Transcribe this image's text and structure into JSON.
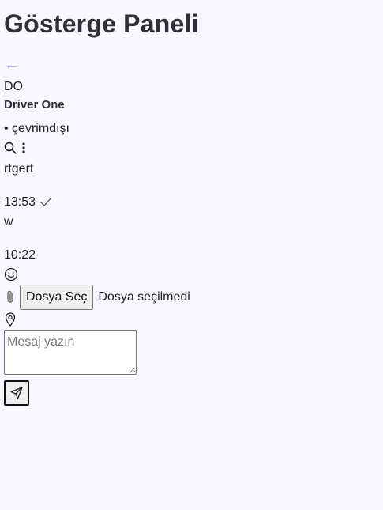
{
  "page": {
    "title": "Gösterge Paneli"
  },
  "chat_header": {
    "back_arrow": "←",
    "avatar_initials": "DO",
    "contact_name": "Driver One",
    "status": "• çevrimdışı",
    "icons": [
      "search-icon",
      "more-vertical-icon"
    ]
  },
  "messages": [
    {
      "text": "rtgert",
      "time": "13:53",
      "read_receipt": "check-icon"
    },
    {
      "text": "w",
      "time": "10:22"
    }
  ],
  "composer": {
    "emoji_icon": "smile-icon",
    "attach_icon": "paperclip-icon",
    "file_button_label": "Dosya Seç",
    "file_status": "Dosya seçilmedi",
    "location_icon": "map-pin-icon",
    "input_placeholder": "Mesaj yazın",
    "input_value": "",
    "send_icon": "send-icon"
  },
  "colors": {
    "background": "#f8f7ff",
    "title": "#2f2f38",
    "back_arrow": "#b8aee6"
  }
}
